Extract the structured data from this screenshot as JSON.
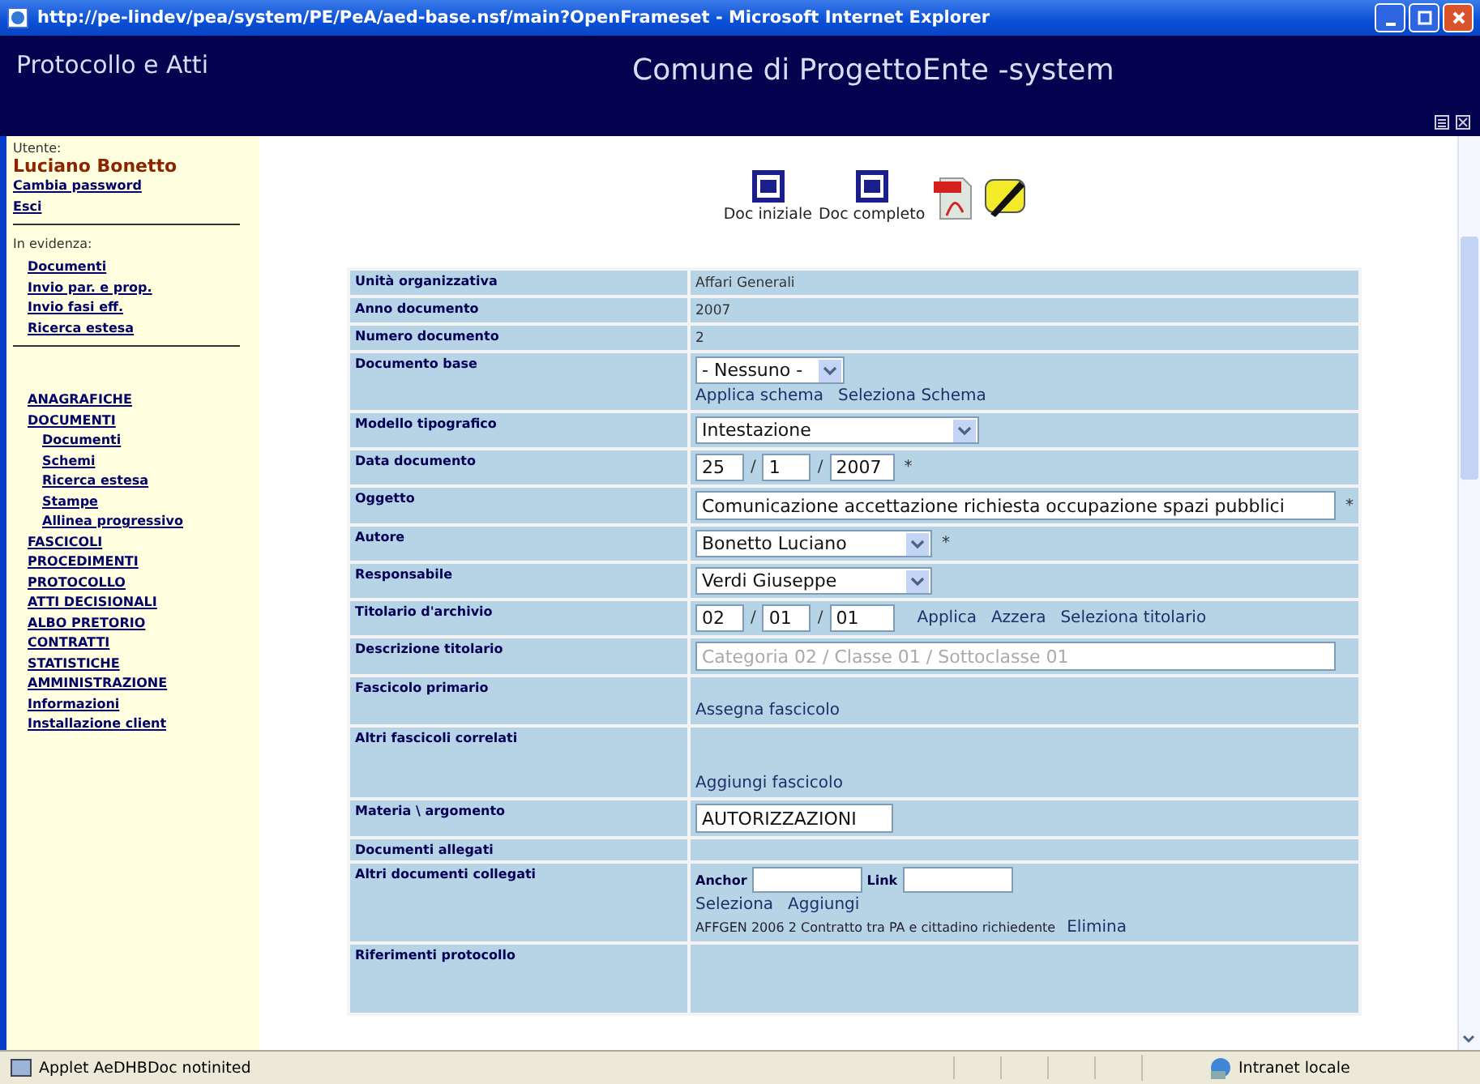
{
  "window": {
    "title": "http://pe-lindev/pea/system/PE/PeA/aed-base.nsf/main?OpenFrameset - Microsoft Internet Explorer"
  },
  "header": {
    "app_title": "Protocollo e Atti",
    "site_title": "Comune di ProgettoEnte -system"
  },
  "sidebar": {
    "user_label": "Utente:",
    "user_name": "Luciano Bonetto",
    "user_links": [
      "Cambia password",
      "Esci"
    ],
    "highlight_label": "In evidenza:",
    "highlight_links": [
      "Documenti",
      "Invio par. e prop.",
      "Invio fasi eff.",
      "Ricerca estesa"
    ],
    "menu": [
      {
        "label": "ANAGRAFICHE"
      },
      {
        "label": "DOCUMENTI",
        "children": [
          {
            "label": "Documenti"
          },
          {
            "label": "Schemi"
          },
          {
            "label": "Ricerca estesa"
          },
          {
            "label": "Stampe"
          },
          {
            "label": "Allinea progressivo"
          }
        ]
      },
      {
        "label": "FASCICOLI"
      },
      {
        "label": "PROCEDIMENTI"
      },
      {
        "label": "PROTOCOLLO"
      },
      {
        "label": "ATTI DECISIONALI"
      },
      {
        "label": "ALBO PRETORIO"
      },
      {
        "label": "CONTRATTI"
      },
      {
        "label": "STATISTICHE"
      },
      {
        "label": "AMMINISTRAZIONE"
      },
      {
        "label": "Informazioni"
      },
      {
        "label": "Installazione client"
      }
    ]
  },
  "toolbar": [
    {
      "kind": "word",
      "label": "Doc iniziale"
    },
    {
      "kind": "word",
      "label": "Doc completo"
    },
    {
      "kind": "pdf"
    },
    {
      "kind": "sign"
    }
  ],
  "form": [
    {
      "kind": "text",
      "label": "Unità organizzativa",
      "value": "Affari Generali"
    },
    {
      "kind": "text",
      "label": "Anno documento",
      "value": "2007"
    },
    {
      "kind": "text",
      "label": "Numero documento",
      "value": "2"
    },
    {
      "kind": "select",
      "label": "Documento base",
      "value": "- Nessuno -",
      "links": [
        "Applica schema",
        "Seleziona Schema"
      ]
    },
    {
      "kind": "select",
      "label": "Modello tipografico",
      "value": "Intestazione"
    },
    {
      "kind": "parts",
      "label": "Data documento",
      "parts": [
        "25",
        "1",
        "2007"
      ],
      "separators": [
        "/",
        "/"
      ],
      "required_mark": "*"
    },
    {
      "kind": "input",
      "label": "Oggetto",
      "value": "Comunicazione accettazione richiesta occupazione spazi pubblici",
      "required_mark": "*"
    },
    {
      "kind": "select",
      "label": "Autore",
      "value": "Bonetto Luciano",
      "required_mark": "*"
    },
    {
      "kind": "select",
      "label": "Responsabile",
      "value": "Verdi Giuseppe"
    },
    {
      "kind": "parts",
      "label": "Titolario d'archivio",
      "parts": [
        "02",
        "01",
        "01"
      ],
      "separators": [
        "/",
        "/"
      ],
      "links": [
        "Applica",
        "Azzera",
        "Seleziona titolario"
      ]
    },
    {
      "kind": "input",
      "label": "Descrizione titolario",
      "value": "Categoria 02 / Classe 01 / Sottoclasse 01",
      "disabled": true
    },
    {
      "kind": "links",
      "label": "Fascicolo primario",
      "links": [
        "Assegna fascicolo"
      ]
    },
    {
      "kind": "links",
      "label": "Altri fascicoli correlati",
      "links": [
        "Aggiungi fascicolo"
      ]
    },
    {
      "kind": "input",
      "label": "Materia \\ argomento",
      "value": "AUTORIZZAZIONI"
    },
    {
      "kind": "empty",
      "label": "Documenti allegati"
    },
    {
      "kind": "related",
      "label": "Altri documenti collegati",
      "anchor_label": "Anchor",
      "link_label": "Link",
      "links": [
        "Seleziona",
        "Aggiungi"
      ],
      "item": "AFFGEN 2006 2 Contratto tra PA e cittadino richiedente",
      "item_action": "Elimina"
    },
    {
      "kind": "empty",
      "label": "Riferimenti protocollo"
    }
  ],
  "status_bar": {
    "text": "Applet AeDHBDoc notinited",
    "zone": "Intranet locale"
  }
}
